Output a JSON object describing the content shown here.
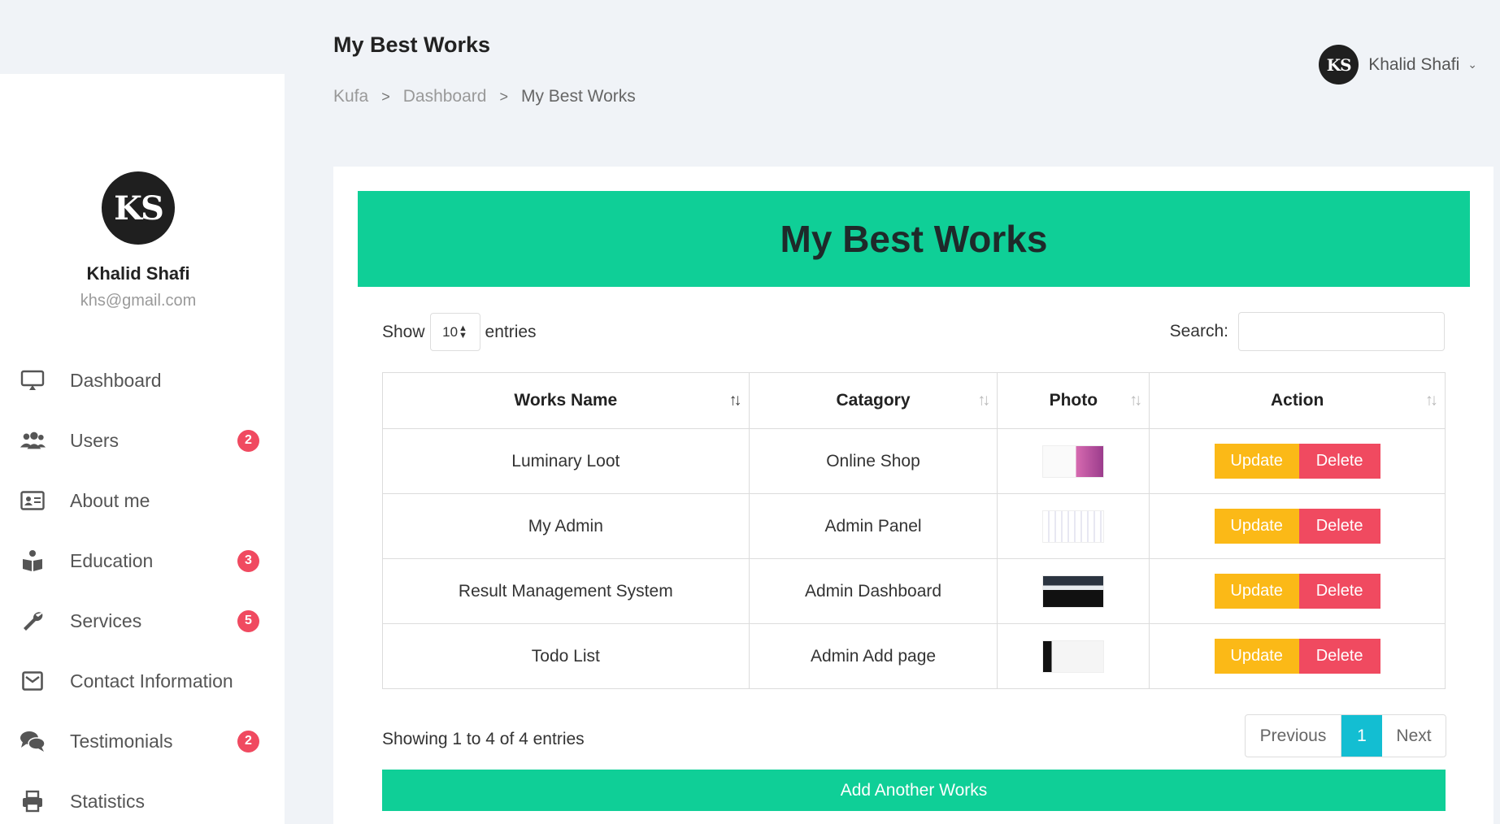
{
  "header": {
    "title": "My Best Works",
    "breadcrumb": [
      "Kufa",
      "Dashboard",
      "My Best Works"
    ],
    "user_name": "Khalid Shafi"
  },
  "sidebar": {
    "profile": {
      "name": "Khalid Shafi",
      "email": "khs@gmail.com",
      "avatar_text": "KS"
    },
    "items": [
      {
        "label": "Dashboard",
        "icon": "monitor-icon",
        "badge": ""
      },
      {
        "label": "Users",
        "icon": "users-icon",
        "badge": "2"
      },
      {
        "label": "About me",
        "icon": "id-card-icon",
        "badge": ""
      },
      {
        "label": "Education",
        "icon": "education-icon",
        "badge": "3"
      },
      {
        "label": "Services",
        "icon": "wrench-icon",
        "badge": "5"
      },
      {
        "label": "Contact Information",
        "icon": "envelope-icon",
        "badge": ""
      },
      {
        "label": "Testimonials",
        "icon": "comments-icon",
        "badge": "2"
      },
      {
        "label": "Statistics",
        "icon": "printer-icon",
        "badge": ""
      }
    ]
  },
  "main": {
    "banner_title": "My Best Works",
    "show_label": "Show",
    "entries_value": "10",
    "entries_label": "entries",
    "search_label": "Search:",
    "search_value": "",
    "columns": [
      "Works Name",
      "Catagory",
      "Photo",
      "Action"
    ],
    "rows": [
      {
        "name": "Luminary Loot",
        "category": "Online Shop",
        "photo": "luminary-loot-thumbnail"
      },
      {
        "name": "My Admin",
        "category": "Admin Panel",
        "photo": "my-admin-thumbnail"
      },
      {
        "name": "Result Management System",
        "category": "Admin Dashboard",
        "photo": "result-management-thumbnail"
      },
      {
        "name": "Todo List",
        "category": "Admin Add page",
        "photo": "todo-list-thumbnail"
      }
    ],
    "update_label": "Update",
    "delete_label": "Delete",
    "info_text": "Showing 1 to 4 of 4 entries",
    "pagination": {
      "previous": "Previous",
      "current": "1",
      "next": "Next"
    },
    "add_button": "Add Another Works"
  },
  "colors": {
    "accent": "#0fcf97",
    "update": "#fbb917",
    "delete": "#f04a60",
    "badge": "#f04a60",
    "page_active": "#13bed2"
  }
}
